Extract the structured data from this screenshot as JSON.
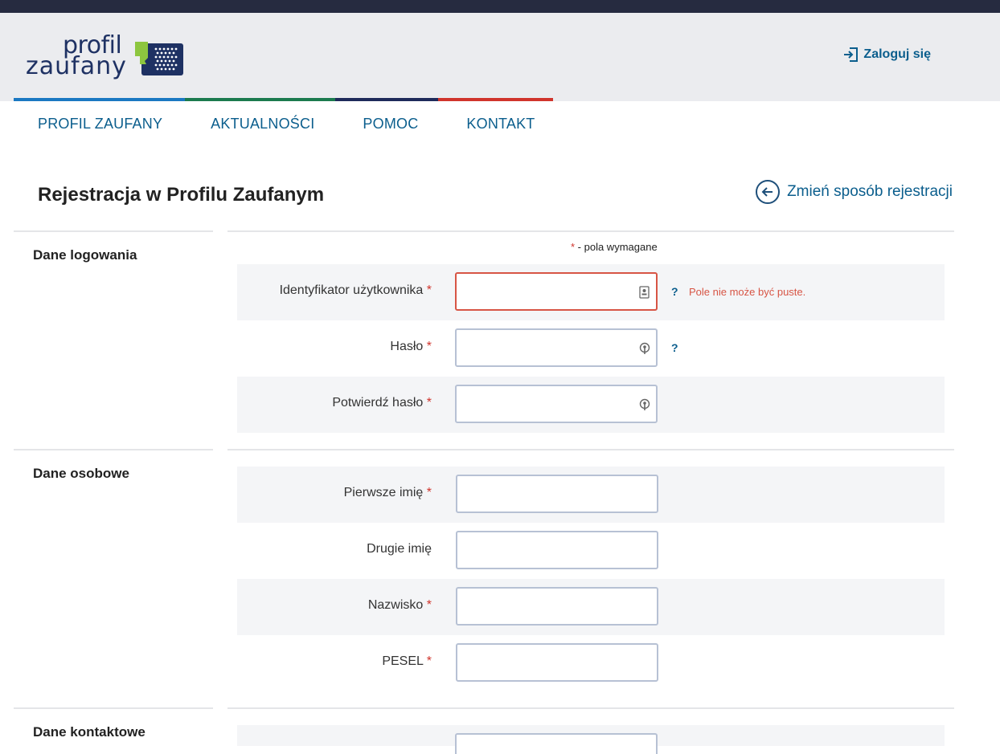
{
  "header": {
    "logo_line1": "profil",
    "logo_line2": "zaufany",
    "login_label": "Zaloguj się"
  },
  "nav": {
    "items": [
      {
        "label": "PROFIL ZAUFANY",
        "color": "#1a78c2"
      },
      {
        "label": "AKTUALNOŚCI",
        "color": "#1b7a4e"
      },
      {
        "label": "POMOC",
        "color": "#1e2a5a"
      },
      {
        "label": "KONTAKT",
        "color": "#d0342c"
      }
    ]
  },
  "page": {
    "title": "Rejestracja w Profilu Zaufanym",
    "change_method_label": "Zmień sposób rejestracji",
    "required_star": "*",
    "required_note": " - pola wymagane"
  },
  "sections": {
    "login": {
      "title": "Dane logowania",
      "fields": [
        {
          "label": "Identyfikator użytkownika",
          "required": "*",
          "value": "",
          "help": "?",
          "error": "Pole nie może być puste.",
          "icon": "id-card-icon"
        },
        {
          "label": "Hasło",
          "required": "*",
          "value": "",
          "help": "?",
          "icon": "key-icon"
        },
        {
          "label": "Potwierdź hasło",
          "required": "*",
          "value": "",
          "icon": "key-icon"
        }
      ]
    },
    "personal": {
      "title": "Dane osobowe",
      "fields": [
        {
          "label": "Pierwsze imię",
          "required": "*",
          "value": ""
        },
        {
          "label": "Drugie imię",
          "required": "",
          "value": ""
        },
        {
          "label": "Nazwisko",
          "required": "*",
          "value": ""
        },
        {
          "label": "PESEL",
          "required": "*",
          "value": ""
        }
      ]
    },
    "contact": {
      "title": "Dane kontaktowe"
    }
  },
  "colors": {
    "accent": "#0b5e8d",
    "error": "#d75545",
    "topbar": "#262b40"
  }
}
